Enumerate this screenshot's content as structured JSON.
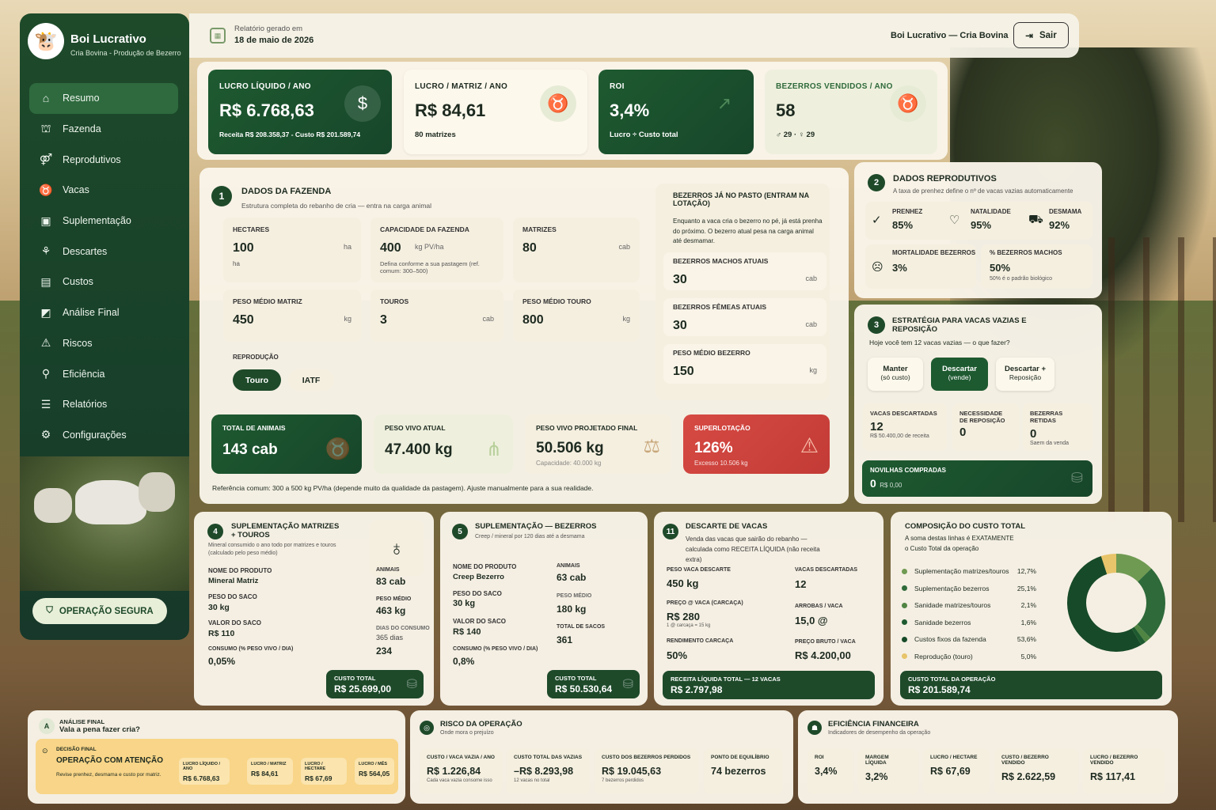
{
  "app": {
    "name": "Boi Lucrativo",
    "subtitle": "Cria Bovina - Produção de Bezerro"
  },
  "nav": [
    {
      "label": "Resumo",
      "icon": "home-icon"
    },
    {
      "label": "Fazenda",
      "icon": "farm-icon"
    },
    {
      "label": "Reprodutivos",
      "icon": "reproduction-icon"
    },
    {
      "label": "Vacas",
      "icon": "cow-icon"
    },
    {
      "label": "Suplementação",
      "icon": "supplement-icon"
    },
    {
      "label": "Descartes",
      "icon": "discard-icon"
    },
    {
      "label": "Custos",
      "icon": "costs-icon"
    },
    {
      "label": "Análise Final",
      "icon": "analysis-icon"
    },
    {
      "label": "Riscos",
      "icon": "risk-icon"
    },
    {
      "label": "Eficiência",
      "icon": "efficiency-icon"
    },
    {
      "label": "Relatórios",
      "icon": "reports-icon"
    },
    {
      "label": "Configurações",
      "icon": "settings-icon"
    }
  ],
  "sidebar_badge": "OPERAÇÃO SEGURA",
  "header": {
    "generated_label": "Relatório gerado em",
    "date": "18 de maio de 2026",
    "brand": "Boi Lucrativo — Cria Bovina",
    "logout": "Sair"
  },
  "kpis": [
    {
      "label": "LUCRO LÍQUIDO / ANO",
      "value": "R$ 6.768,63",
      "sub": "Receita R$ 208.358,37 - Custo R$ 201.589,74"
    },
    {
      "label": "LUCRO / MATRIZ / ANO",
      "value": "R$ 84,61",
      "sub": "80 matrizes"
    },
    {
      "label": "ROI",
      "value": "3,4%",
      "sub": "Lucro ÷ Custo total"
    },
    {
      "label": "BEZERROS VENDIDOS / ANO",
      "value": "58",
      "sub": "♂ 29 · ♀ 29"
    }
  ],
  "farm": {
    "num": "1",
    "title": "DADOS DA FAZENDA",
    "subtitle": "Estrutura completa do rebanho de cria — entra na carga animal",
    "hectares": {
      "label": "HECTARES",
      "value": "100",
      "unit": "ha",
      "hint": "ha"
    },
    "capacity": {
      "label": "CAPACIDADE DA FAZENDA",
      "value": "400",
      "unit": "kg PV/ha",
      "hint": "Defina conforme a sua pastagem (ref. comum: 300–500)"
    },
    "matrizes": {
      "label": "MATRIZES",
      "value": "80",
      "unit": "cab"
    },
    "peso_matriz": {
      "label": "PESO MÉDIO MATRIZ",
      "value": "450",
      "unit": "kg"
    },
    "touros": {
      "label": "TOUROS",
      "value": "3",
      "unit": "cab"
    },
    "peso_touro": {
      "label": "PESO MÉDIO TOURO",
      "value": "800",
      "unit": "kg"
    },
    "reproducao_label": "REPRODUÇÃO",
    "repro_options": [
      "Touro",
      "IATF"
    ],
    "calves_note_title": "BEZERROS JÁ NO PASTO (ENTRAM NA LOTAÇÃO)",
    "calves_note": "Enquanto a vaca cria o bezerro no pé, já está prenha do próximo. O bezerro atual pesa na carga animal até desmamar.",
    "machos": {
      "label": "BEZERROS MACHOS ATUAIS",
      "value": "30",
      "unit": "cab"
    },
    "femeas": {
      "label": "BEZERROS FÊMEAS ATUAIS",
      "value": "30",
      "unit": "cab"
    },
    "peso_bezerro": {
      "label": "PESO MÉDIO BEZERRO",
      "value": "150",
      "unit": "kg"
    },
    "summary": [
      {
        "label": "TOTAL DE ANIMAIS",
        "value": "143 cab",
        "sub": ""
      },
      {
        "label": "PESO VIVO ATUAL",
        "value": "47.400 kg",
        "sub": ""
      },
      {
        "label": "PESO VIVO PROJETADO FINAL",
        "value": "50.506 kg",
        "sub": "Capacidade: 40.000 kg"
      },
      {
        "label": "SUPERLOTAÇÃO",
        "value": "126%",
        "sub": "Excesso 10.506 kg"
      }
    ],
    "reference": "Referência comum: 300 a 500 kg PV/ha (depende muito da qualidade da pastagem). Ajuste manualmente para a sua realidade."
  },
  "repro": {
    "num": "2",
    "title": "DADOS REPRODUTIVOS",
    "subtitle": "A taxa de prenhez define o nº de vacas vazias automaticamente",
    "items": [
      {
        "label": "PRENHEZ",
        "value": "85%"
      },
      {
        "label": "NATALIDADE",
        "value": "95%"
      },
      {
        "label": "DESMAMA",
        "value": "92%"
      }
    ],
    "mortalidade": {
      "label": "MORTALIDADE BEZERROS",
      "value": "3%"
    },
    "machos": {
      "label": "% BEZERROS MACHOS",
      "value": "50%",
      "hint": "50% é o padrão biológico"
    }
  },
  "strategy": {
    "num": "3",
    "title": "ESTRATÉGIA PARA VACAS VAZIAS E REPOSIÇÃO",
    "subtitle": "Hoje você tem 12 vacas vazias — o que fazer?",
    "options": [
      {
        "l1": "Manter",
        "l2": "(só custo)"
      },
      {
        "l1": "Descartar",
        "l2": "(vende)"
      },
      {
        "l1": "Descartar +",
        "l2": "Reposição"
      }
    ],
    "stats": [
      {
        "label": "VACAS DESCARTADAS",
        "value": "12",
        "hint": "R$ 50.400,00 de receita"
      },
      {
        "label": "NECESSIDADE DE REPOSIÇÃO",
        "value": "0",
        "hint": ""
      },
      {
        "label": "BEZERRAS RETIDAS",
        "value": "0",
        "hint": "Saem da venda"
      }
    ],
    "novilhas": {
      "label": "NOVILHAS COMPRADAS",
      "value": "0",
      "hint": "R$ 0,00"
    }
  },
  "sup_matriz": {
    "num": "4",
    "title": "SUPLEMENTAÇÃO MATRIZES + TOUROS",
    "subtitle": "Mineral consumido o ano todo por matrizes e touros (calculado pelo peso médio)",
    "left": [
      {
        "label": "NOME DO PRODUTO",
        "value": "Mineral Matriz"
      },
      {
        "label": "PESO DO SACO",
        "value": "30 kg"
      },
      {
        "label": "VALOR DO SACO",
        "value": "R$ 110"
      },
      {
        "label": "CONSUMO (% PESO VIVO / DIA)",
        "value": "0,05%"
      }
    ],
    "right": [
      {
        "label": "ANIMAIS",
        "value": "83 cab"
      },
      {
        "label": "PESO MÉDIO",
        "value": "463 kg"
      },
      {
        "label": "DIAS DO CONSUMO",
        "value": "365 dias"
      },
      {
        "label": "",
        "value": "234"
      }
    ],
    "total": {
      "label": "CUSTO TOTAL",
      "value": "R$ 25.699,00"
    }
  },
  "sup_bez": {
    "num": "5",
    "title": "SUPLEMENTAÇÃO — BEZERROS",
    "subtitle": "Creep / mineral por 120 dias até a desmama",
    "left": [
      {
        "label": "NOME DO PRODUTO",
        "value": "Creep Bezerro"
      },
      {
        "label": "PESO DO SACO",
        "value": "30 kg"
      },
      {
        "label": "VALOR DO SACO",
        "value": "R$ 140"
      },
      {
        "label": "CONSUMO (% PESO VIVO / DIA)",
        "value": "0,8%"
      }
    ],
    "right": [
      {
        "label": "ANIMAIS",
        "value": "63 cab"
      },
      {
        "label": "PESO MÉDIO",
        "value": "180 kg"
      },
      {
        "label": "TOTAL DE SACOS",
        "value": "361"
      }
    ],
    "total": {
      "label": "CUSTO TOTAL",
      "value": "R$ 50.530,64"
    }
  },
  "descarte": {
    "num": "11",
    "title": "DESCARTE DE VACAS",
    "subtitle": "Venda das vacas que sairão do rebanho — calculada como RECEITA LÍQUIDA (não receita extra)",
    "left": [
      {
        "label": "PESO VACA DESCARTE",
        "value": "450 kg",
        "hint": ""
      },
      {
        "label": "PREÇO @ VACA (CARCAÇA)",
        "value": "R$ 280",
        "hint": "1 @ carcaça = 15 kg"
      },
      {
        "label": "RENDIMENTO CARCAÇA",
        "value": "50%",
        "hint": ""
      }
    ],
    "right": [
      {
        "label": "VACAS DESCARTADAS",
        "value": "12"
      },
      {
        "label": "ARROBAS / VACA",
        "value": "15,0 @"
      },
      {
        "label": "PREÇO BRUTO / VACA",
        "value": "R$ 4.200,00"
      }
    ],
    "total": {
      "label": "RECEITA LÍQUIDA TOTAL — 12 VACAS",
      "value": "R$ 2.797,98"
    }
  },
  "composition": {
    "title": "COMPOSIÇÃO DO CUSTO TOTAL",
    "subtitle": "A soma destas linhas é EXATAMENTE o Custo Total da operação",
    "total": {
      "label": "CUSTO TOTAL DA OPERAÇÃO",
      "value": "R$ 201.589,74"
    }
  },
  "chart_data": {
    "type": "pie",
    "categories": [
      "Suplementação matrizes/touros",
      "Suplementação bezerros",
      "Sanidade matrizes/touros",
      "Sanidade bezerros",
      "Custos fixos da fazenda",
      "Reprodução (touro)"
    ],
    "values": [
      12.7,
      25.1,
      2.1,
      1.6,
      53.6,
      5.0
    ],
    "labels": [
      "12,7%",
      "25,1%",
      "2,1%",
      "1,6%",
      "53,6%",
      "5,0%"
    ],
    "colors": [
      "#6f9a52",
      "#2f6a3a",
      "#4f8443",
      "#1e5a30",
      "#174a28",
      "#e8c46a"
    ],
    "legend": "left"
  },
  "analysis": {
    "title1": "ANÁLISE FINAL",
    "title2": "Vala a pena fazer cria?",
    "decision_label": "DECISÃO FINAL",
    "decision": "OPERAÇÃO COM ATENÇÃO",
    "decision_text": "Revise prenhez, desmama e custo por matriz.",
    "metrics": [
      {
        "label": "LUCRO LÍQUIDO / ANO",
        "value": "R$ 6.768,63"
      },
      {
        "label": "LUCRO / MATRIZ",
        "value": "R$ 84,61"
      },
      {
        "label": "LUCRO / HECTARE",
        "value": "R$ 67,69"
      },
      {
        "label": "LUCRO / MÊS",
        "value": "R$ 564,05"
      }
    ]
  },
  "risk": {
    "title": "RISCO DA OPERAÇÃO",
    "subtitle": "Onde mora o prejuízo",
    "items": [
      {
        "label": "CUSTO / VACA VAZIA / ANO",
        "value": "R$ 1.226,84",
        "hint": "Cada vaca vazia consome isso"
      },
      {
        "label": "CUSTO TOTAL DAS VAZIAS",
        "value": "–R$ 8.293,98",
        "hint": "12 vacas no total"
      },
      {
        "label": "CUSTO DOS BEZERROS PERDIDOS",
        "value": "R$ 19.045,63",
        "hint": "7 bezerros perdidos"
      },
      {
        "label": "PONTO DE EQUILÍBRIO",
        "value": "74 bezerros",
        "hint": ""
      }
    ]
  },
  "efficiency": {
    "title": "EFICIÊNCIA FINANCEIRA",
    "subtitle": "Indicadores de desempenho da operação",
    "items": [
      {
        "label": "ROI",
        "value": "3,4%"
      },
      {
        "label": "MARGEM LÍQUIDA",
        "value": "3,2%"
      },
      {
        "label": "LUCRO / HECTARE",
        "value": "R$ 67,69"
      },
      {
        "label": "CUSTO / BEZERRO VENDIDO",
        "value": "R$ 2.622,59"
      },
      {
        "label": "LUCRO / BEZERRO VENDIDO",
        "value": "R$ 117,41"
      }
    ]
  }
}
